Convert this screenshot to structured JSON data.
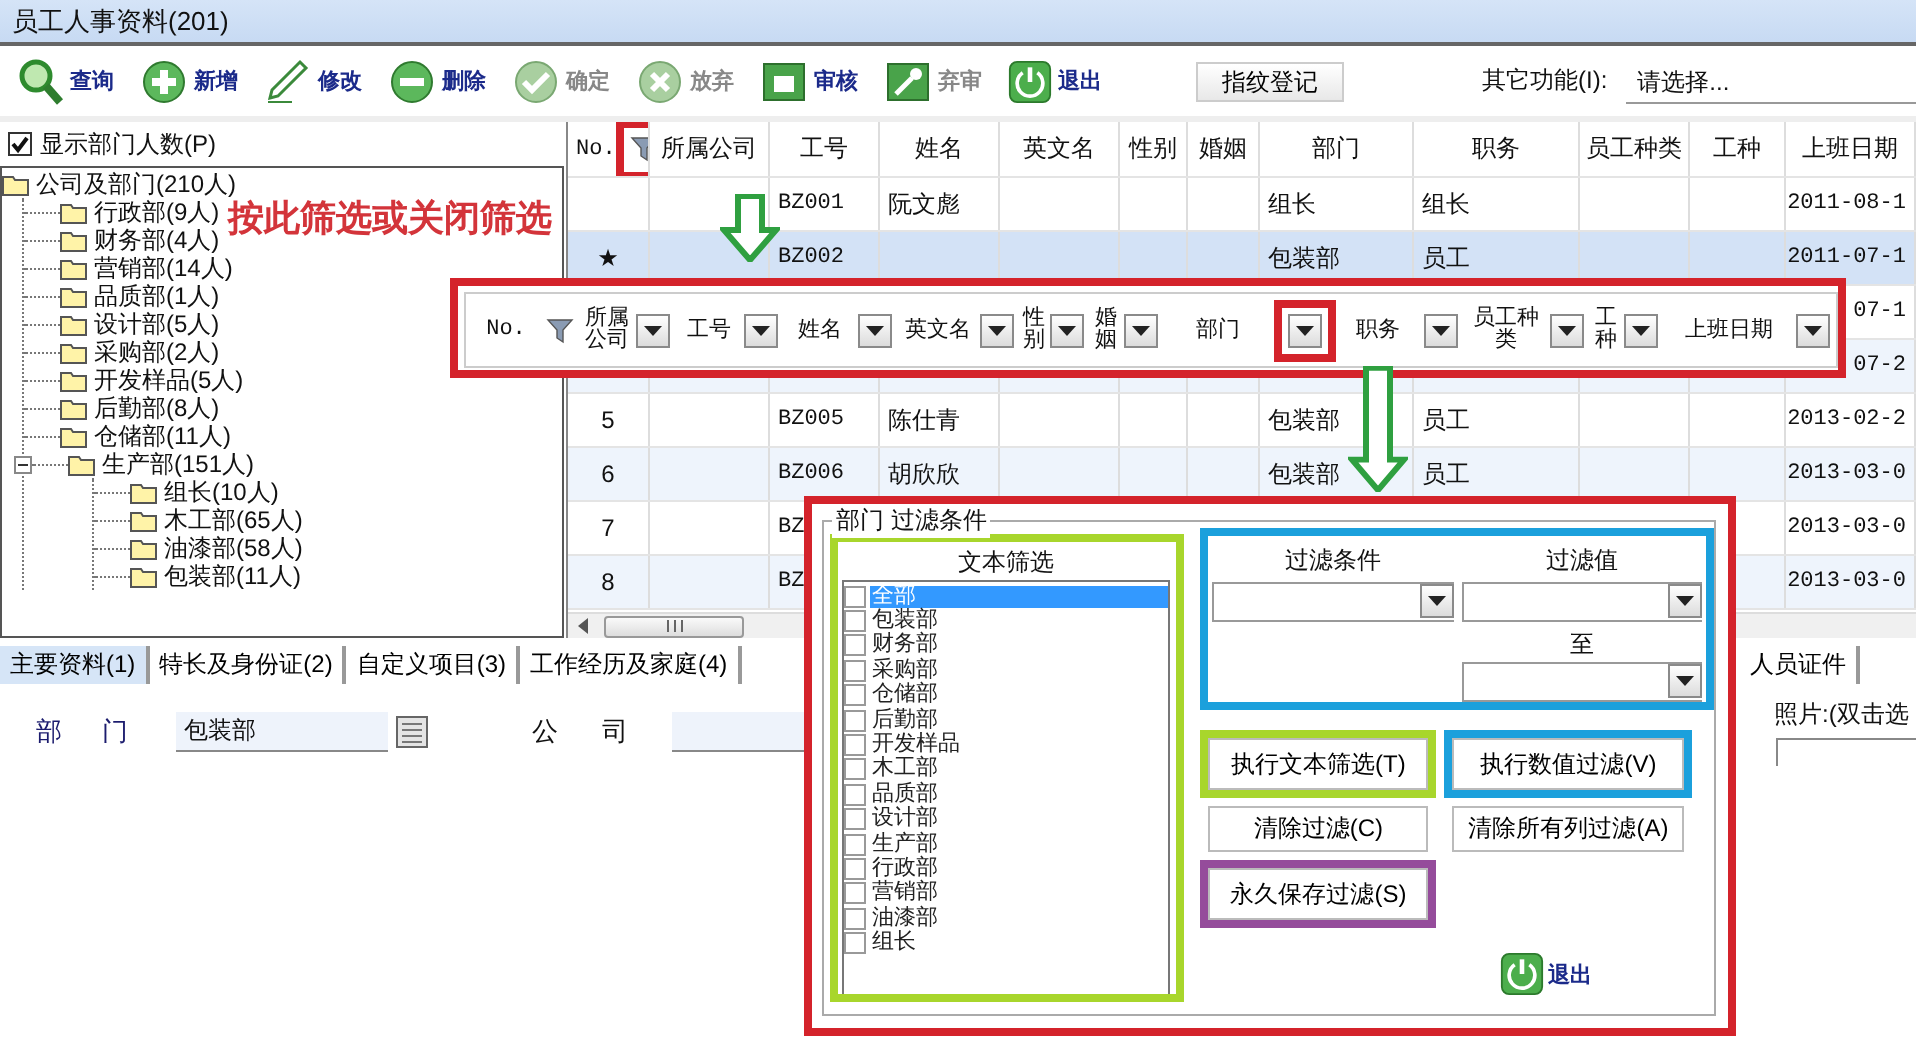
{
  "window": {
    "title": "员工人事资料(201)"
  },
  "toolbar": {
    "buttons": [
      {
        "label": "查询",
        "kind": "search",
        "disabled": false
      },
      {
        "label": "新增",
        "kind": "add",
        "disabled": false
      },
      {
        "label": "修改",
        "kind": "edit",
        "disabled": false
      },
      {
        "label": "删除",
        "kind": "delete",
        "disabled": false
      },
      {
        "label": "确定",
        "kind": "confirm",
        "disabled": true
      },
      {
        "label": "放弃",
        "kind": "cancel",
        "disabled": true
      },
      {
        "label": "审核",
        "kind": "audit",
        "disabled": false
      },
      {
        "label": "弃审",
        "kind": "unaudit",
        "disabled": true
      },
      {
        "label": "退出",
        "kind": "exit",
        "disabled": false
      }
    ],
    "fingerprint_button": "指纹登记",
    "other_functions": {
      "label": "其它功能(I):",
      "value": "请选择..."
    }
  },
  "dept_panel": {
    "show_counts": {
      "label": "显示部门人数(P)",
      "checked": true
    },
    "tree": [
      {
        "label": "公司及部门(210人)",
        "expanded": true,
        "children": [
          {
            "label": "行政部(9人)"
          },
          {
            "label": "财务部(4人)"
          },
          {
            "label": "营销部(14人)"
          },
          {
            "label": "品质部(1人)"
          },
          {
            "label": "设计部(5人)"
          },
          {
            "label": "采购部(2人)"
          },
          {
            "label": "开发样品(5人)"
          },
          {
            "label": "后勤部(8人)"
          },
          {
            "label": "仓储部(11人)"
          },
          {
            "label": "生产部(151人)",
            "expanded": true,
            "children": [
              {
                "label": "组长(10人)"
              },
              {
                "label": "木工部(65人)"
              },
              {
                "label": "油漆部(58人)"
              },
              {
                "label": "包装部(11人)"
              }
            ]
          }
        ]
      }
    ]
  },
  "grid": {
    "filter_button": {
      "highlighted": true
    },
    "columns": [
      "No.",
      "所属公司",
      "工号",
      "姓名",
      "英文名",
      "性别",
      "婚姻",
      "部门",
      "职务",
      "员工种类",
      "工种",
      "上班日期"
    ],
    "rows": [
      {
        "selected": false,
        "emp_id": "BZ001",
        "name": "阮文彪",
        "dept": "组长",
        "position": "组长",
        "start_date": "2011-08-1"
      },
      {
        "selected": true,
        "marker": "★",
        "emp_id": "BZ002",
        "dept": "包装部",
        "position": "员工",
        "start_date": "2011-07-1"
      },
      {
        "selected": false,
        "start_date": "07-1"
      },
      {
        "selected": false,
        "start_date": "07-2"
      },
      {
        "selected": false,
        "marker": "5",
        "emp_id": "BZ005",
        "name": "陈仕青",
        "dept": "包装部",
        "position": "员工",
        "start_date": "2013-02-2"
      },
      {
        "selected": false,
        "marker": "6",
        "emp_id": "BZ006",
        "name": "胡欣欣",
        "dept": "包装部",
        "position": "员工",
        "start_date": "2013-03-0"
      },
      {
        "selected": false,
        "marker": "7",
        "emp_id": "BZ",
        "start_date": "2013-03-0"
      },
      {
        "selected": false,
        "marker": "8",
        "emp_id": "BZ",
        "start_date": "2013-03-0"
      }
    ]
  },
  "annotation": {
    "caption": "按此筛选或关闭筛选"
  },
  "filter_header": {
    "columns": [
      {
        "label": "No.",
        "kind": "filter"
      },
      {
        "label": "所属公司",
        "highlighted": false
      },
      {
        "label": "工号",
        "highlighted": false
      },
      {
        "label": "姓名",
        "highlighted": false
      },
      {
        "label": "英文名",
        "highlighted": false
      },
      {
        "label": "性别",
        "highlighted": false
      },
      {
        "label": "婚姻",
        "highlighted": false
      },
      {
        "label": "部门",
        "highlighted": true
      },
      {
        "label": "职务",
        "highlighted": false
      },
      {
        "label": "员工种类",
        "highlighted": false
      },
      {
        "label": "工种",
        "highlighted": false
      },
      {
        "label": "上班日期",
        "highlighted": false
      }
    ]
  },
  "filter_dialog": {
    "group_title": "部门 过滤条件",
    "text_filter": {
      "title": "文本筛选",
      "color": "#a8d62c",
      "items": [
        {
          "label": "全部",
          "checked": false,
          "selected": true
        },
        {
          "label": "包装部",
          "checked": false,
          "selected": false
        },
        {
          "label": "财务部",
          "checked": false,
          "selected": false
        },
        {
          "label": "采购部",
          "checked": false,
          "selected": false
        },
        {
          "label": "仓储部",
          "checked": false,
          "selected": false
        },
        {
          "label": "后勤部",
          "checked": false,
          "selected": false
        },
        {
          "label": "开发样品",
          "checked": false,
          "selected": false
        },
        {
          "label": "木工部",
          "checked": false,
          "selected": false
        },
        {
          "label": "品质部",
          "checked": false,
          "selected": false
        },
        {
          "label": "设计部",
          "checked": false,
          "selected": false
        },
        {
          "label": "生产部",
          "checked": false,
          "selected": false
        },
        {
          "label": "行政部",
          "checked": false,
          "selected": false
        },
        {
          "label": "营销部",
          "checked": false,
          "selected": false
        },
        {
          "label": "油漆部",
          "checked": false,
          "selected": false
        },
        {
          "label": "组长",
          "checked": false,
          "selected": false
        }
      ]
    },
    "value_filter": {
      "color": "#1ba0dc",
      "condition_label": "过滤条件",
      "value_label": "过滤值",
      "to_label": "至"
    },
    "buttons": [
      {
        "label": "执行文本筛选(T)",
        "color": "#a8d62c"
      },
      {
        "label": "执行数值过滤(V)",
        "color": "#1ba0dc"
      },
      {
        "label": "清除过滤(C)"
      },
      {
        "label": "清除所有列过滤(A)"
      },
      {
        "label": "永久保存过滤(S)",
        "color": "#954c9b"
      }
    ],
    "exit_button": "退出"
  },
  "detail": {
    "tabs": [
      {
        "label": "主要资料(1)",
        "selected": true
      },
      {
        "label": "特长及身份证(2)",
        "selected": false
      },
      {
        "label": "自定义项目(3)",
        "selected": false
      },
      {
        "label": "工作经历及家庭(4)",
        "selected": false
      },
      {
        "label": "人员证件",
        "selected": false
      }
    ],
    "fields": [
      {
        "label": "部门",
        "value": "包装部",
        "kind": "lookup"
      },
      {
        "label": "公司",
        "kind": "text"
      }
    ],
    "photo_label": "照片:(双击选"
  }
}
